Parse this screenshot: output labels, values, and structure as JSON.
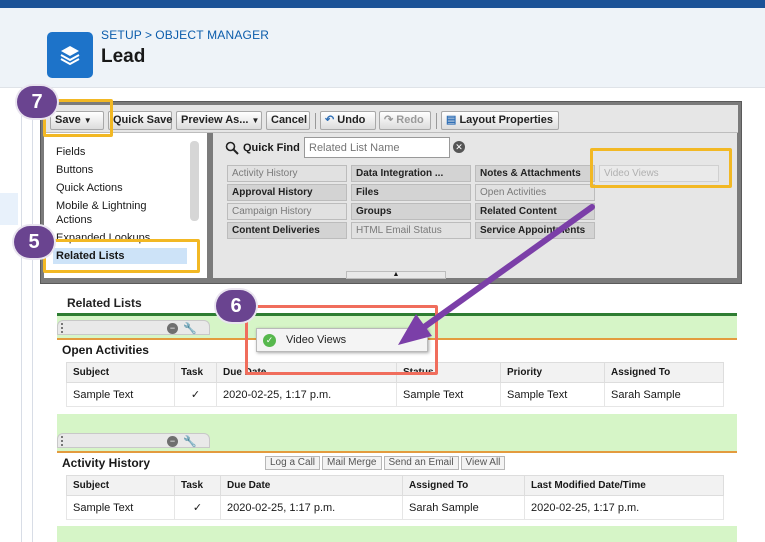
{
  "header": {
    "breadcrumb": [
      "SETUP",
      "OBJECT MANAGER"
    ],
    "breadcrumb_sep": ">",
    "title": "Lead",
    "icon": "layers-icon"
  },
  "toolbar": {
    "save": "Save",
    "quick_save": "Quick Save",
    "preview_as": "Preview As...",
    "cancel": "Cancel",
    "undo": "Undo",
    "redo": "Redo",
    "layout_properties": "Layout Properties"
  },
  "palette": {
    "categories": [
      "Fields",
      "Buttons",
      "Quick Actions",
      "Mobile & Lightning",
      "Actions",
      "Expanded Lookups",
      "Related Lists"
    ],
    "selected_category": "Related Lists",
    "quick_find_label": "Quick Find",
    "quick_find_placeholder": "Related List Name",
    "items": [
      "Activity History",
      "Data Integration ...",
      "Notes & Attachments",
      "Video Views",
      "Approval History",
      "Files",
      "Open Activities",
      "Campaign History",
      "Groups",
      "Related Content",
      "Content Deliveries",
      "HTML Email Status",
      "Service Appointments"
    ]
  },
  "layout": {
    "section_title": "Related Lists",
    "open_activities": {
      "name": "Open Activities",
      "columns": [
        "Subject",
        "Task",
        "Due Date",
        "Status",
        "Priority",
        "Assigned To"
      ],
      "row": [
        "Sample Text",
        "✓",
        "2020-02-25, 1:17 p.m.",
        "Sample Text",
        "Sample Text",
        "Sarah Sample"
      ]
    },
    "activity_history": {
      "name": "Activity History",
      "buttons": [
        "Log a Call",
        "Mail Merge",
        "Send an Email",
        "View All"
      ],
      "columns": [
        "Subject",
        "Task",
        "Due Date",
        "Assigned To",
        "Last Modified Date/Time"
      ],
      "row": [
        "Sample Text",
        "✓",
        "2020-02-25, 1:17 p.m.",
        "Sarah Sample",
        "2020-02-25, 1:17 p.m."
      ]
    }
  },
  "drag_preview": {
    "label": "Video Views"
  },
  "callouts": {
    "c5": "5",
    "c6": "6",
    "c7": "7"
  },
  "colors": {
    "callout": "#6a4490",
    "highlight_yellow": "#f2b824",
    "highlight_red": "#f06d5c",
    "arrow": "#7b3fa8",
    "brand": "#1d73c9"
  }
}
